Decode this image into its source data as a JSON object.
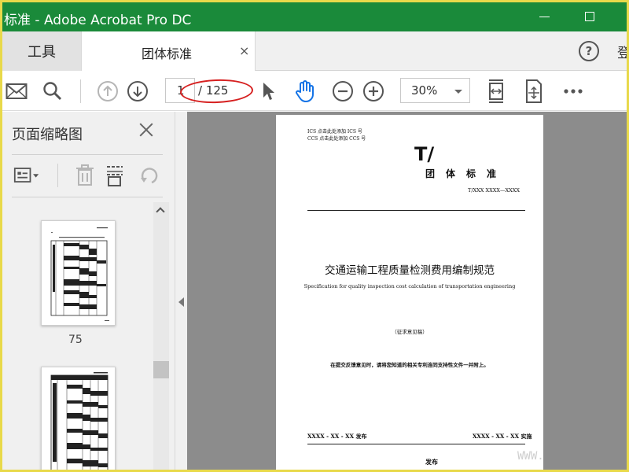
{
  "window": {
    "title": "标准 - Adobe Acrobat Pro DC",
    "controls": [
      "minimize",
      "maximize"
    ]
  },
  "tabs": {
    "tools_label": "工具",
    "document_label": "团体标准",
    "close_glyph": "×",
    "help_glyph": "?",
    "login_label": "登"
  },
  "toolbar": {
    "current_page": "1",
    "page_total": "/ 125",
    "zoom": "30%",
    "icons": [
      "mail-icon",
      "search-icon",
      "prev-page-icon",
      "next-page-icon",
      "select-cursor-icon",
      "hand-tool-icon",
      "zoom-out-icon",
      "zoom-in-icon",
      "fit-page-icon",
      "scroll-mode-icon",
      "more-icon"
    ]
  },
  "panel": {
    "title": "页面缩略图",
    "thumbnails": [
      {
        "page_label": "75"
      },
      {
        "page_label": ""
      }
    ]
  },
  "document_page": {
    "ics": "ICS  点击此处添加 ICS 号",
    "ccs": "CCS  点击此处添加 CCS 号",
    "t_mark": "T/",
    "org": "团体标准",
    "number": "T/XXX XXXX—XXXX",
    "title_cn": "交通运输工程质量检测费用编制规范",
    "title_en": "Specification for quality inspection cost calculation of transportation engineering",
    "draft": "（征求意见稿）",
    "note": "在提交反馈意见时，请将您知道的相关专利连同支持性文件一并附上。",
    "publish_date": "XXXX - XX - XX 发布",
    "implement_date": "XXXX - XX - XX 实施",
    "publisher": "发布"
  },
  "watermark": "WWW.",
  "colors": {
    "title_bar": "#1a8a3a",
    "highlight_ellipse": "#d62020",
    "hand_tool": "#1473e6",
    "canvas": "#8c8c8c"
  }
}
